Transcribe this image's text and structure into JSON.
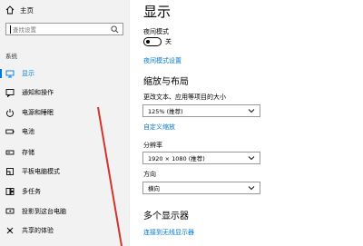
{
  "sidebar": {
    "home_label": "主页",
    "search_placeholder": "查找设置",
    "group_title": "系统",
    "items": [
      {
        "label": "显示",
        "icon": "display-icon",
        "active": true
      },
      {
        "label": "通知和操作",
        "icon": "notification-icon"
      },
      {
        "label": "电源和睡眠",
        "icon": "power-icon"
      },
      {
        "label": "电池",
        "icon": "battery-icon"
      },
      {
        "label": "存储",
        "icon": "storage-icon"
      },
      {
        "label": "平板电脑模式",
        "icon": "tablet-icon"
      },
      {
        "label": "多任务",
        "icon": "multitask-icon"
      },
      {
        "label": "投影到这台电脑",
        "icon": "project-icon"
      },
      {
        "label": "共享的体验",
        "icon": "share-icon"
      }
    ]
  },
  "main": {
    "title": "显示",
    "night_mode_label": "夜间模式",
    "night_mode_state": "关",
    "night_mode_settings_link": "夜间模式设置",
    "scale_layout_title": "缩放与布局",
    "scale_label": "更改文本、应用等项目的大小",
    "scale_value": "125% (推荐)",
    "custom_scale_link": "自定义缩放",
    "resolution_label": "分辨率",
    "resolution_value": "1920 × 1080 (推荐)",
    "orientation_label": "方向",
    "orientation_value": "横向",
    "multi_display_title": "多个显示器",
    "connect_wireless_link": "连接到无线显示器"
  },
  "colors": {
    "accent": "#0078d7",
    "annotation": "#d0342c"
  }
}
